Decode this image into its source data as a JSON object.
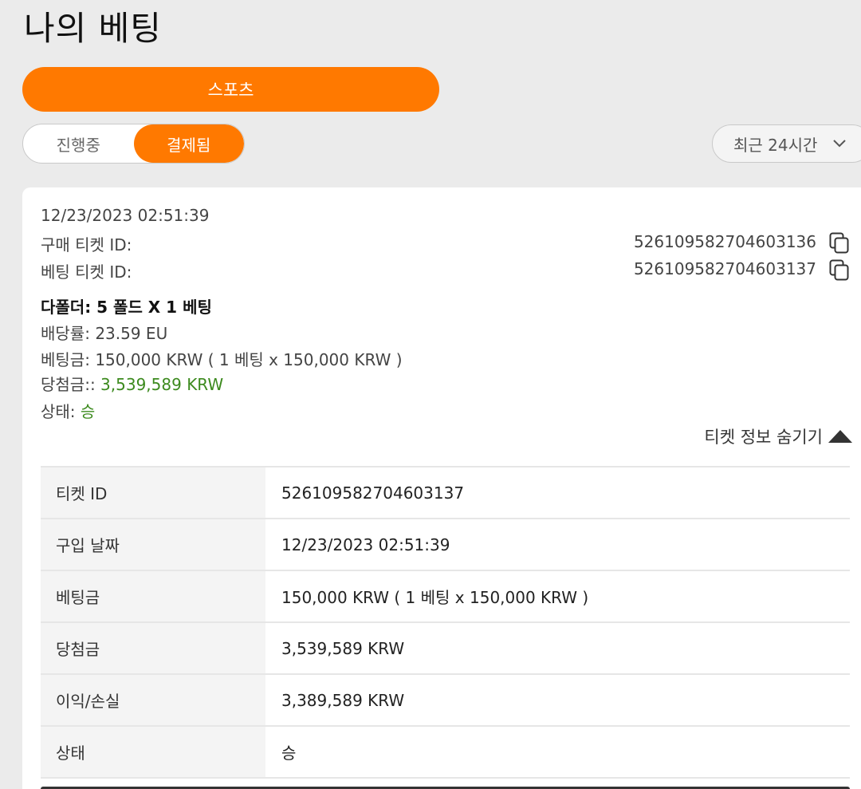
{
  "page_title": "나의 베팅",
  "sports_button": "스포츠",
  "status_tabs": [
    {
      "label": "진행중",
      "active": false
    },
    {
      "label": "결제됨",
      "active": true
    }
  ],
  "period": {
    "label": "최근 24시간",
    "icon": "chevron-down-icon"
  },
  "ticket": {
    "datetime": "12/23/2023 02:51:39",
    "purchase_ticket_label": "구매 티켓 ID:",
    "purchase_ticket_id": "526109582704603136",
    "bet_ticket_label": "베팅 티켓 ID:",
    "bet_ticket_id": "526109582704603137",
    "bet_type": "다폴더: 5 폴드 X 1 베팅",
    "odds_label": "배당률:",
    "odds_value": "23.59 EU",
    "stake_label": "베팅금:",
    "stake_value": "150,000 KRW ( 1 베팅 x 150,000 KRW )",
    "payout_label": "당첨금::",
    "payout_value": "3,539,589 KRW",
    "status_label": "상태:",
    "status_value": "승",
    "hide_info": "티켓 정보 숨기기"
  },
  "details": [
    {
      "label": "티켓 ID",
      "value": "526109582704603137",
      "green": false
    },
    {
      "label": "구입 날짜",
      "value": "12/23/2023 02:51:39",
      "green": false
    },
    {
      "label": "베팅금",
      "value": "150,000 KRW ( 1 베팅 x 150,000 KRW )",
      "green": false
    },
    {
      "label": "당첨금",
      "value": "3,539,589 KRW",
      "green": true
    },
    {
      "label": "이익/손실",
      "value": "3,389,589 KRW",
      "green": true
    },
    {
      "label": "상태",
      "value": "승",
      "green": true
    }
  ],
  "colors": {
    "accent": "#ff7900",
    "positive": "#3c8a1e",
    "background": "#ebebeb"
  }
}
